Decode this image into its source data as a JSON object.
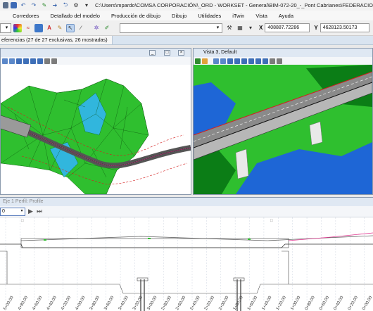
{
  "titlebar": {
    "title": "C:\\Users\\mpardo\\COMSA CORPORACIÓN\\_ORD - WORKSET - General\\BIM-072-20_-_Pont Cabrianes\\FEDERACIO"
  },
  "menu": [
    "Corredores",
    "Detallado del modelo",
    "Producción de dibujo",
    "Dibujo",
    "Utilidades",
    "iTwin",
    "Vista",
    "Ayuda"
  ],
  "toolbar": {
    "x_label": "X",
    "x_value": "408887.72286",
    "y_label": "Y",
    "y_value": "4628123.50173"
  },
  "references": {
    "label": "eferencias (27 de 27 exclusivas, 26 mostradas)"
  },
  "view_left": {
    "title": ""
  },
  "view_right": {
    "title": "Vista 3, Default"
  },
  "profile": {
    "title": "Eje 1 Perfil: Profile",
    "scale_value": "0",
    "station_labels": [
      "5+00.00",
      "4+80.00",
      "4+60.00",
      "4+40.00",
      "4+20.00",
      "4+00.00",
      "3+80.00",
      "3+60.00",
      "3+40.00",
      "3+20.00",
      "3+00.00",
      "2+80.00",
      "2+60.00",
      "2+40.00",
      "2+20.00",
      "2+00.00",
      "1+80.00",
      "1+60.00",
      "1+40.00",
      "1+20.00",
      "1+00.00",
      "0+80.00",
      "0+60.00",
      "0+40.00",
      "0+20.00",
      "0+00.00"
    ]
  },
  "colors": {
    "terrain_green": "#2fbf2f",
    "water_blue": "#1e66d6",
    "ground_dark_green": "#0b7d16",
    "cyan_fill": "#31b6dd",
    "road_grey": "#7a7a7a",
    "accent_pink": "#e0358f"
  }
}
